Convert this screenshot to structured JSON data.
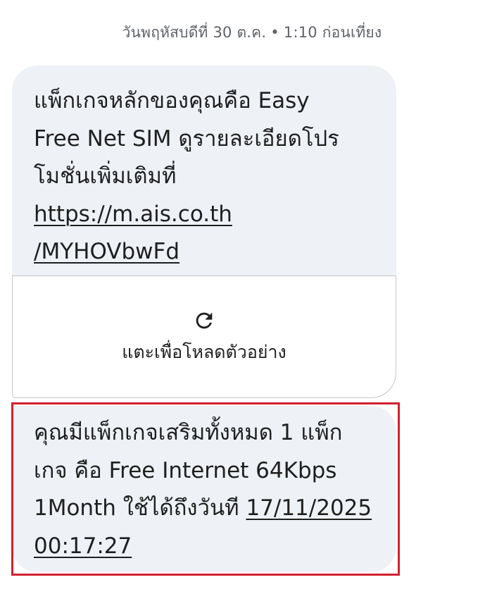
{
  "timestamp": {
    "day": "วันพฤหัสบดีที่ 30 ต.ค.",
    "separator": "•",
    "time": "1:10 ก่อนเที่ยง"
  },
  "message1": {
    "line1": "แพ็กเกจหลักของคุณคือ Easy",
    "line2": "Free Net SIM ดูรายละเอียดโปร",
    "line3": "โมชั่นเพิ่มเติมที่",
    "link_part1": "https://m.ais.co.th",
    "link_part2": "/MYHOVbwFd"
  },
  "preview": {
    "icon": "refresh-icon",
    "label": "แตะเพื่อโหลดตัวอย่าง"
  },
  "message2": {
    "line1": "คุณมีแพ็กเกจเสริมทั้งหมด 1 แพ็ก",
    "line2": "เกจ คือ Free Internet 64Kbps",
    "line3_text": "1Month ใช้ได้ถึงวันที ",
    "date_link": "17/11/2025",
    "time_link": "00:17:27"
  },
  "colors": {
    "bubble_bg": "#eef1f6",
    "highlight_border": "#d2202f",
    "timestamp_text": "#5f6368"
  }
}
